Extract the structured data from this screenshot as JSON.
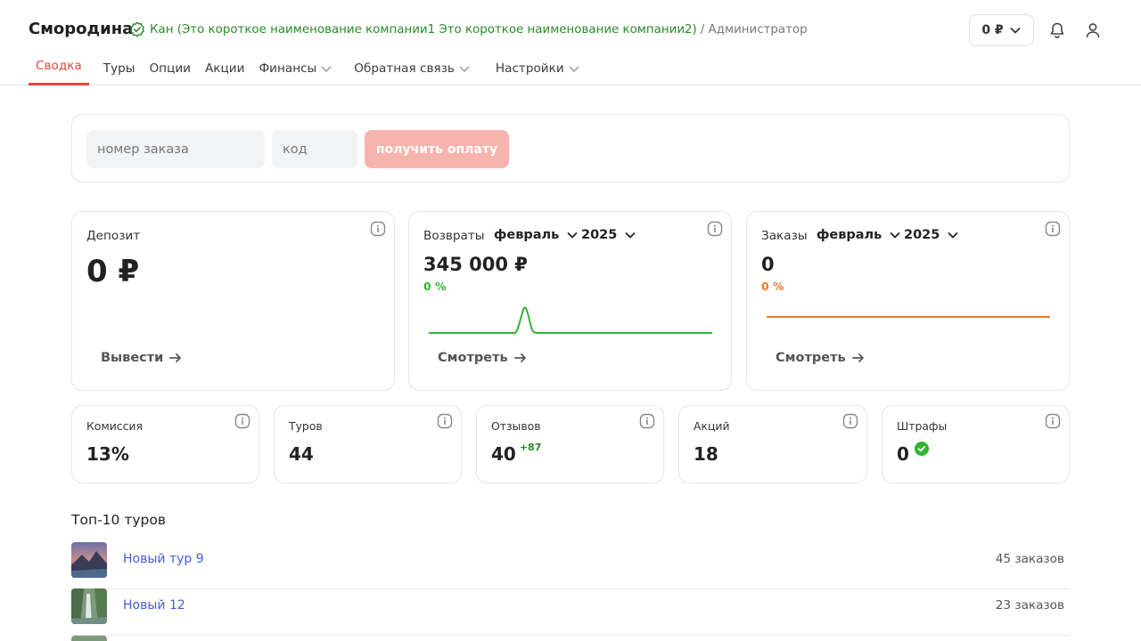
{
  "header": {
    "brand": "Смородина",
    "company_name": "Кан (Это короткое наименование компании1 Это короткое наименование компании2)",
    "role": "/ Администратор",
    "balance": "0 ₽"
  },
  "nav": [
    {
      "label": "Сводка",
      "active": true
    },
    {
      "label": "Туры"
    },
    {
      "label": "Опции"
    },
    {
      "label": "Акции"
    },
    {
      "label": "Финансы",
      "dropdown": true
    },
    {
      "label": "Обратная связь",
      "dropdown": true
    },
    {
      "label": "Настройки",
      "dropdown": true
    }
  ],
  "payment": {
    "order_placeholder": "номер заказа",
    "code_placeholder": "код",
    "button": "получить оплату"
  },
  "deposit": {
    "title": "Депозит",
    "value": "0 ₽",
    "action": "Вывести"
  },
  "returns": {
    "title": "Возвраты",
    "month": "февраль",
    "year": "2025",
    "value": "345 000 ₽",
    "percent": "0 %",
    "action": "Смотреть",
    "line_color": "#2fb52f"
  },
  "orders": {
    "title": "Заказы",
    "month": "февраль",
    "year": "2025",
    "value": "0",
    "percent": "0 %",
    "action": "Смотреть",
    "line_color": "#f07a2a"
  },
  "stats": {
    "commission": {
      "title": "Комиссия",
      "value": "13%"
    },
    "tours": {
      "title": "Туров",
      "value": "44"
    },
    "reviews": {
      "title": "Отзывов",
      "value": "40",
      "delta": "+87"
    },
    "promos": {
      "title": "Акций",
      "value": "18"
    },
    "fines": {
      "title": "Штрафы",
      "value": "0"
    }
  },
  "top_tours": {
    "title": "Топ-10 туров",
    "items": [
      {
        "name": "Новый тур 9",
        "count": "45 заказов"
      },
      {
        "name": "Новый 12",
        "count": "23 заказов"
      }
    ]
  },
  "colors": {
    "accent": "#e0463c",
    "success": "#2a8a2a",
    "link": "#4a5ad8"
  }
}
